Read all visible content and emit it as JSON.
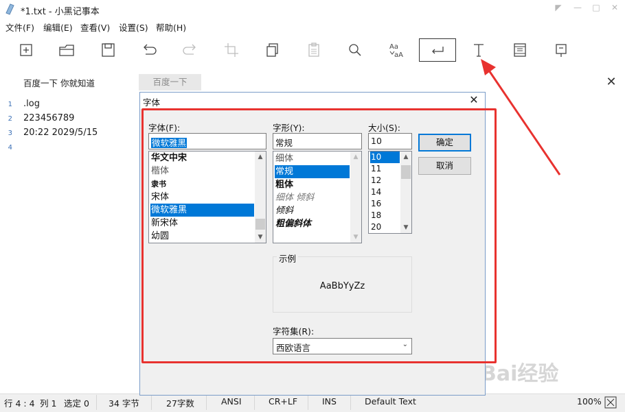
{
  "window": {
    "title": "*1.txt - 小黑记事本"
  },
  "menu": [
    "文件(F)",
    "编辑(E)",
    "查看(V)",
    "设置(S)",
    "帮助(H)"
  ],
  "toolbar": {
    "tools": [
      {
        "icon": "new-icon"
      },
      {
        "icon": "open-icon"
      },
      {
        "icon": "save-icon"
      },
      {
        "icon": "undo-icon"
      },
      {
        "icon": "redo-icon"
      },
      {
        "icon": "crop-icon"
      },
      {
        "icon": "copy-icon"
      },
      {
        "icon": "paste-icon"
      },
      {
        "icon": "search-icon"
      },
      {
        "icon": "replace-icon"
      },
      {
        "icon": "word-wrap-icon",
        "active": true
      },
      {
        "icon": "font-icon"
      },
      {
        "icon": "print-icon"
      },
      {
        "icon": "bookmark-icon"
      }
    ]
  },
  "search": {
    "value": "百度一下 你就知道",
    "button_label": "百度一下"
  },
  "editor": {
    "line_numbers": [
      "1",
      "2",
      "3",
      "4"
    ],
    "lines": [
      ".log",
      "223456789",
      "20:22 2029/5/15",
      ""
    ]
  },
  "statusbar": {
    "position": "行 4 : 4",
    "column": "列 1",
    "selected": "选定 0",
    "bytes": "34 字节",
    "chars": "27字数",
    "encoding": "ANSI",
    "line_ending": "CR+LF",
    "insert_mode": "INS",
    "theme": "Default Text",
    "zoom": "100%"
  },
  "font_dialog": {
    "title": "字体",
    "font_label": "字体(F):",
    "font_value": "微软雅黑",
    "font_list": [
      "华文中宋",
      "楷体",
      "隶书",
      "宋体",
      "微软雅黑",
      "新宋体",
      "幼圆"
    ],
    "font_selected": "微软雅黑",
    "style_label": "字形(Y):",
    "style_value": "常规",
    "style_list": [
      "细体",
      "常规",
      "粗体",
      "细体 倾斜",
      "倾斜",
      "粗偏斜体"
    ],
    "style_selected": "常规",
    "size_label": "大小(S):",
    "size_value": "10",
    "size_list": [
      "10",
      "11",
      "12",
      "14",
      "16",
      "18",
      "20"
    ],
    "size_selected": "10",
    "ok_label": "确定",
    "cancel_label": "取消",
    "sample_label": "示例",
    "sample_text": "AaBbYyZz",
    "charset_label": "字符集(R):",
    "charset_value": "西欧语言"
  },
  "annotation": {
    "highlight_color": "#e8322f"
  },
  "watermark": {
    "text": "Bai经验"
  },
  "colors": {
    "accent": "#0078d7",
    "line_numbers": "#3a6fb5"
  }
}
